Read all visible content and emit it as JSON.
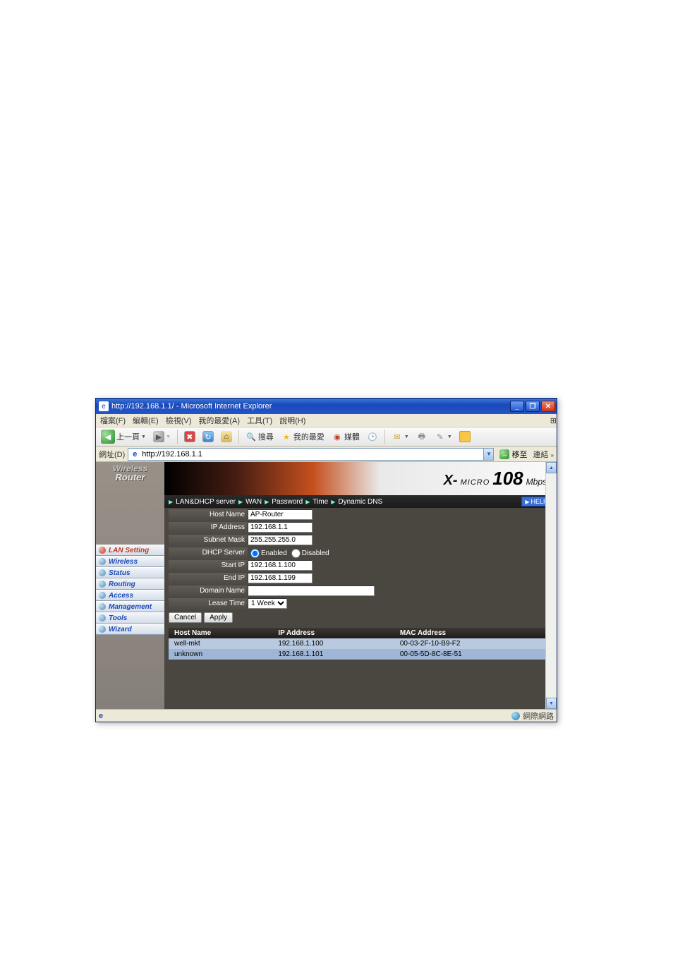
{
  "window": {
    "title": "http://192.168.1.1/ - Microsoft Internet Explorer",
    "min": "_",
    "max": "❐",
    "close": "✕"
  },
  "menubar": {
    "file": "檔案(F)",
    "edit": "編輯(E)",
    "view": "檢視(V)",
    "fav": "我的最愛(A)",
    "tools": "工具(T)",
    "help": "說明(H)"
  },
  "toolbar": {
    "back": "上一頁",
    "search": "搜尋",
    "fav": "我的最愛",
    "media": "媒體"
  },
  "addressbar": {
    "label": "網址(D)",
    "url": "http://192.168.1.1",
    "go": "移至",
    "links": "連結"
  },
  "sidebar": {
    "logo1": "Wireless",
    "logo2": "Router",
    "items": [
      "LAN Setting",
      "Wireless",
      "Status",
      "Routing",
      "Access",
      "Management",
      "Tools",
      "Wizard"
    ]
  },
  "brand": {
    "prefix": "X-",
    "micro": "MICRO",
    "num": "108",
    "suffix": "Mbps"
  },
  "subnav": {
    "tab1": "LAN&DHCP server",
    "tab2": "WAN",
    "tab3": "Password",
    "tab4": "Time",
    "tab5": "Dynamic DNS",
    "help": "HELP"
  },
  "form": {
    "hostname_label": "Host Name",
    "hostname": "AP-Router",
    "ip_label": "IP Address",
    "ip": "192.168.1.1",
    "subnet_label": "Subnet Mask",
    "subnet": "255.255.255.0",
    "dhcp_label": "DHCP Server",
    "enabled": "Enabled",
    "disabled": "Disabled",
    "startip_label": "Start IP",
    "startip": "192.168.1.100",
    "endip_label": "End IP",
    "endip": "192.168.1.199",
    "domain_label": "Domain Name",
    "domain": "",
    "lease_label": "Lease Time",
    "lease": "1 Week",
    "cancel": "Cancel",
    "apply": "Apply"
  },
  "clients": {
    "h_host": "Host Name",
    "h_ip": "IP Address",
    "h_mac": "MAC Address",
    "rows": [
      {
        "host": "well-mkt",
        "ip": "192.168.1.100",
        "mac": "00-03-2F-10-B9-F2"
      },
      {
        "host": "unknown",
        "ip": "192.168.1.101",
        "mac": "00-05-5D-8C-8E-51"
      }
    ]
  },
  "statusbar": {
    "zone": "網際網路"
  }
}
